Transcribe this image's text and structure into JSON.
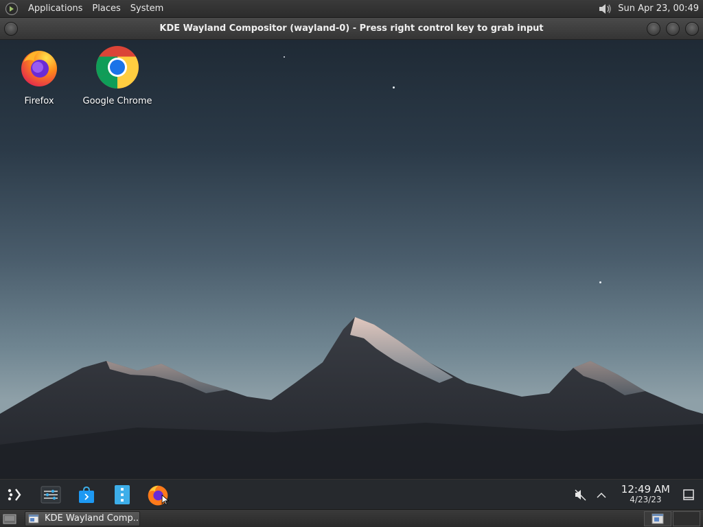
{
  "top_panel": {
    "menus": [
      "Applications",
      "Places",
      "System"
    ],
    "clock": "Sun Apr 23, 00:49",
    "icons": [
      "gnome-foot-icon",
      "speaker-icon"
    ]
  },
  "window": {
    "title": "KDE Wayland Compositor (wayland-0) - Press right control key to grab input"
  },
  "desktop": {
    "icons": [
      {
        "label": "Firefox",
        "icon": "firefox-icon"
      },
      {
        "label": "Google Chrome",
        "icon": "chrome-icon"
      }
    ]
  },
  "plasma_panel": {
    "launchers": [
      "app-launcher-icon",
      "system-settings-icon",
      "discover-icon",
      "file-manager-icon",
      "firefox-icon"
    ],
    "tray": {
      "icons": [
        "volume-muted-icon",
        "expand-tray-icon"
      ],
      "time": "12:49 AM",
      "date": "4/23/23"
    }
  },
  "bottom_bar": {
    "task_label": "KDE Wayland Comp...",
    "icons": [
      "show-desktop-icon",
      "window-icon",
      "workspace-switcher-icon"
    ]
  },
  "colors": {
    "panel": "#2c2c2c",
    "plasma_panel": "#26292d",
    "sky_top": "#1f2a35",
    "sky_horizon": "#8ea0a8"
  }
}
